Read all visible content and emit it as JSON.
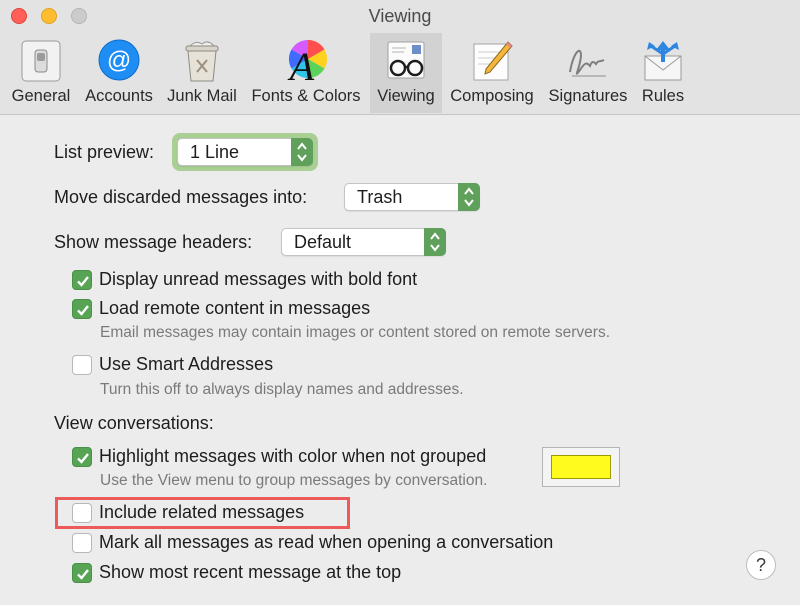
{
  "window": {
    "title": "Viewing"
  },
  "toolbar": {
    "tabs": [
      {
        "label": "General",
        "icon": "switch-icon"
      },
      {
        "label": "Accounts",
        "icon": "at-sign-icon"
      },
      {
        "label": "Junk Mail",
        "icon": "trash-can-icon"
      },
      {
        "label": "Fonts & Colors",
        "icon": "color-wheel-font-icon"
      },
      {
        "label": "Viewing",
        "icon": "glasses-envelope-icon",
        "selected": true
      },
      {
        "label": "Composing",
        "icon": "pencil-paper-icon"
      },
      {
        "label": "Signatures",
        "icon": "signature-icon"
      },
      {
        "label": "Rules",
        "icon": "rules-envelope-icon"
      }
    ]
  },
  "settings": {
    "list_preview": {
      "label": "List preview:",
      "value": "1 Line"
    },
    "move_discarded": {
      "label": "Move discarded messages into:",
      "value": "Trash"
    },
    "show_headers": {
      "label": "Show message headers:",
      "value": "Default"
    },
    "checkboxes": [
      {
        "label": "Display unread messages with bold font",
        "checked": true
      },
      {
        "label": "Load remote content in messages",
        "checked": true,
        "note": "Email messages may contain images or content stored on remote servers."
      },
      {
        "label": "Use Smart Addresses",
        "checked": false,
        "note": "Turn this off to always display names and addresses."
      }
    ],
    "view_conversations": {
      "heading": "View conversations:",
      "highlight": {
        "label": "Highlight messages with color when not grouped",
        "checked": true,
        "note": "Use the View menu to group messages by conversation.",
        "color": "#fffb1f"
      },
      "include_related": {
        "label": "Include related messages",
        "checked": false
      },
      "mark_all_read": {
        "label": "Mark all messages as read when opening a conversation",
        "checked": false
      },
      "most_recent_top": {
        "label": "Show most recent message at the top",
        "checked": true
      }
    }
  },
  "help": {
    "label": "?"
  },
  "colors": {
    "accent_green": "#57a454",
    "highlight_yellow": "#fffb1f",
    "annotation_red": "#ec5a5a"
  }
}
